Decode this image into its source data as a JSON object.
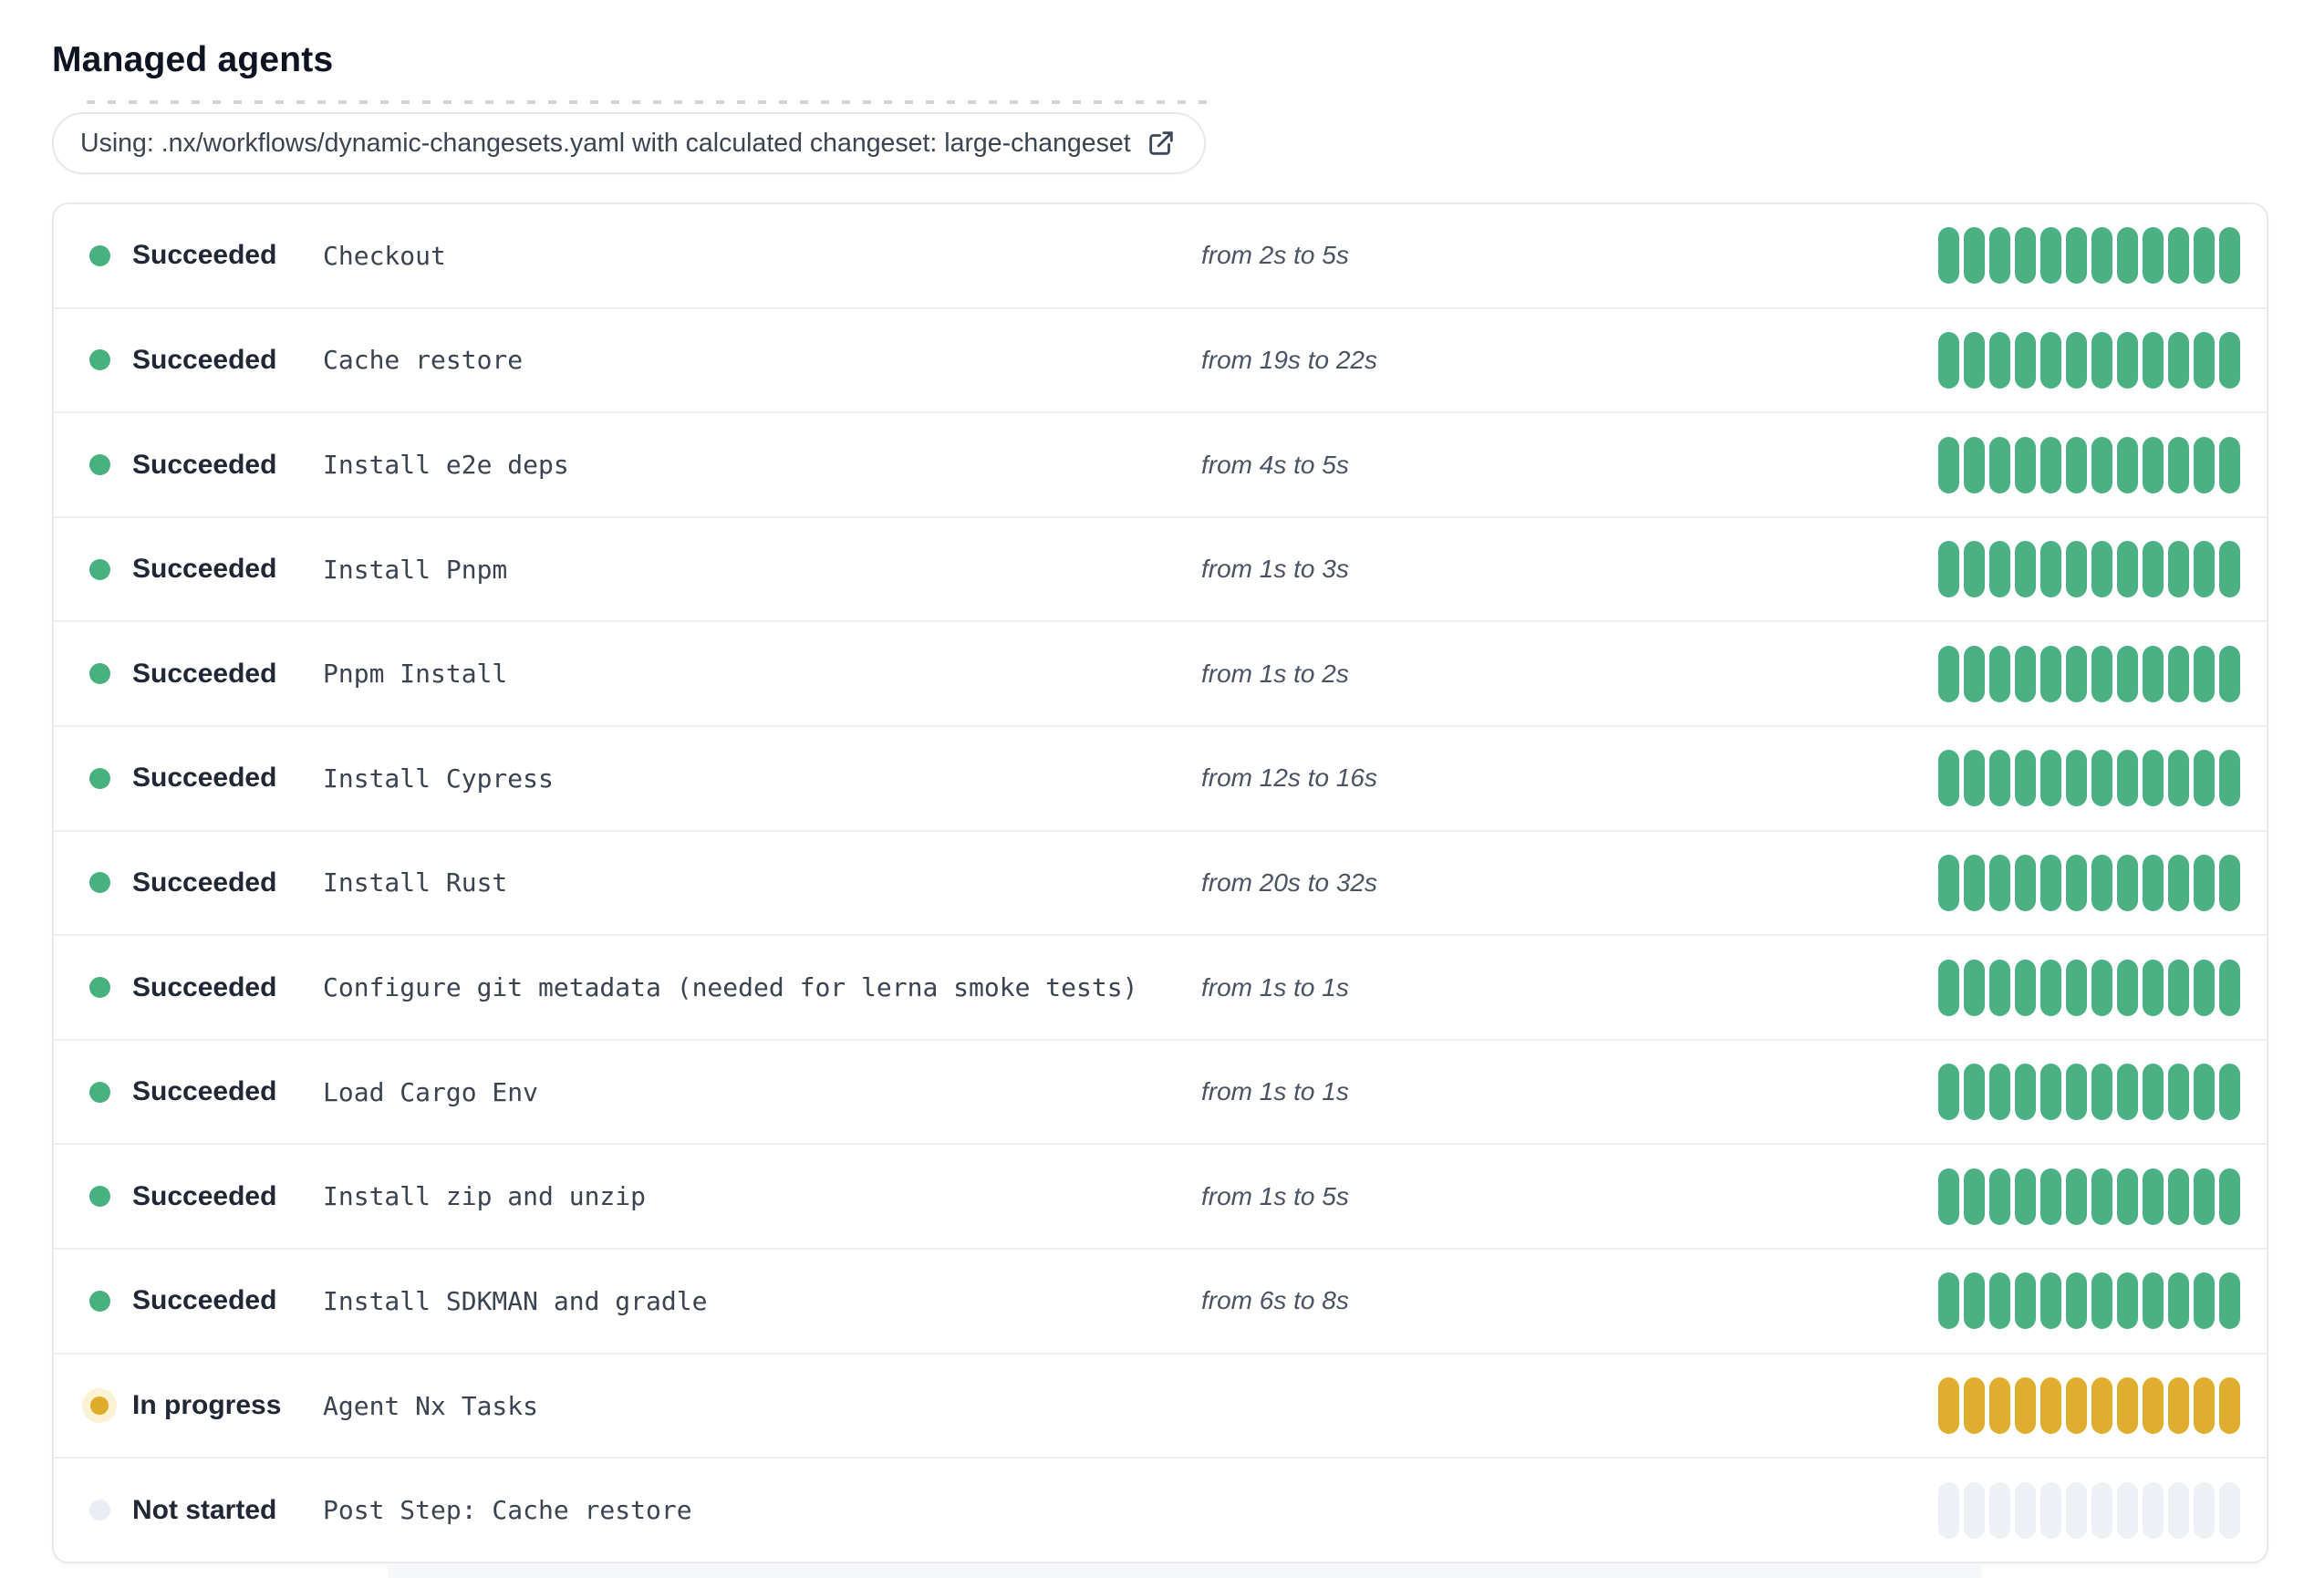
{
  "page": {
    "title": "Managed agents"
  },
  "workflow_banner": {
    "text": "Using: .nx/workflows/dynamic-changesets.yaml with calculated changeset: large-changeset",
    "icon": "external-link-icon"
  },
  "colors": {
    "succeeded": "#4bb183",
    "succeeded_dot": "#49b07f",
    "in_progress": "#e0ae2e",
    "in_progress_dot": "#dfac29",
    "in_progress_halo": "#faf2d2",
    "not_started": "#edf1f6",
    "not_started_dot": "#e9edf2"
  },
  "agents": {
    "segments_per_row": 12,
    "rows": [
      {
        "status": "Succeeded",
        "state": "succeeded",
        "name": "Checkout",
        "duration": "from 2s to 5s"
      },
      {
        "status": "Succeeded",
        "state": "succeeded",
        "name": "Cache restore",
        "duration": "from 19s to 22s"
      },
      {
        "status": "Succeeded",
        "state": "succeeded",
        "name": "Install e2e deps",
        "duration": "from 4s to 5s"
      },
      {
        "status": "Succeeded",
        "state": "succeeded",
        "name": "Install Pnpm",
        "duration": "from 1s to 3s"
      },
      {
        "status": "Succeeded",
        "state": "succeeded",
        "name": "Pnpm Install",
        "duration": "from 1s to 2s"
      },
      {
        "status": "Succeeded",
        "state": "succeeded",
        "name": "Install Cypress",
        "duration": "from 12s to 16s"
      },
      {
        "status": "Succeeded",
        "state": "succeeded",
        "name": "Install Rust",
        "duration": "from 20s to 32s"
      },
      {
        "status": "Succeeded",
        "state": "succeeded",
        "name": "Configure git metadata (needed for lerna smoke tests)",
        "duration": "from 1s to 1s"
      },
      {
        "status": "Succeeded",
        "state": "succeeded",
        "name": "Load Cargo Env",
        "duration": "from 1s to 1s"
      },
      {
        "status": "Succeeded",
        "state": "succeeded",
        "name": "Install zip and unzip",
        "duration": "from 1s to 5s"
      },
      {
        "status": "Succeeded",
        "state": "succeeded",
        "name": "Install SDKMAN and gradle",
        "duration": "from 6s to 8s"
      },
      {
        "status": "In progress",
        "state": "in_progress",
        "name": "Agent Nx Tasks",
        "duration": ""
      },
      {
        "status": "Not started",
        "state": "not_started",
        "name": "Post Step: Cache restore",
        "duration": ""
      }
    ]
  }
}
